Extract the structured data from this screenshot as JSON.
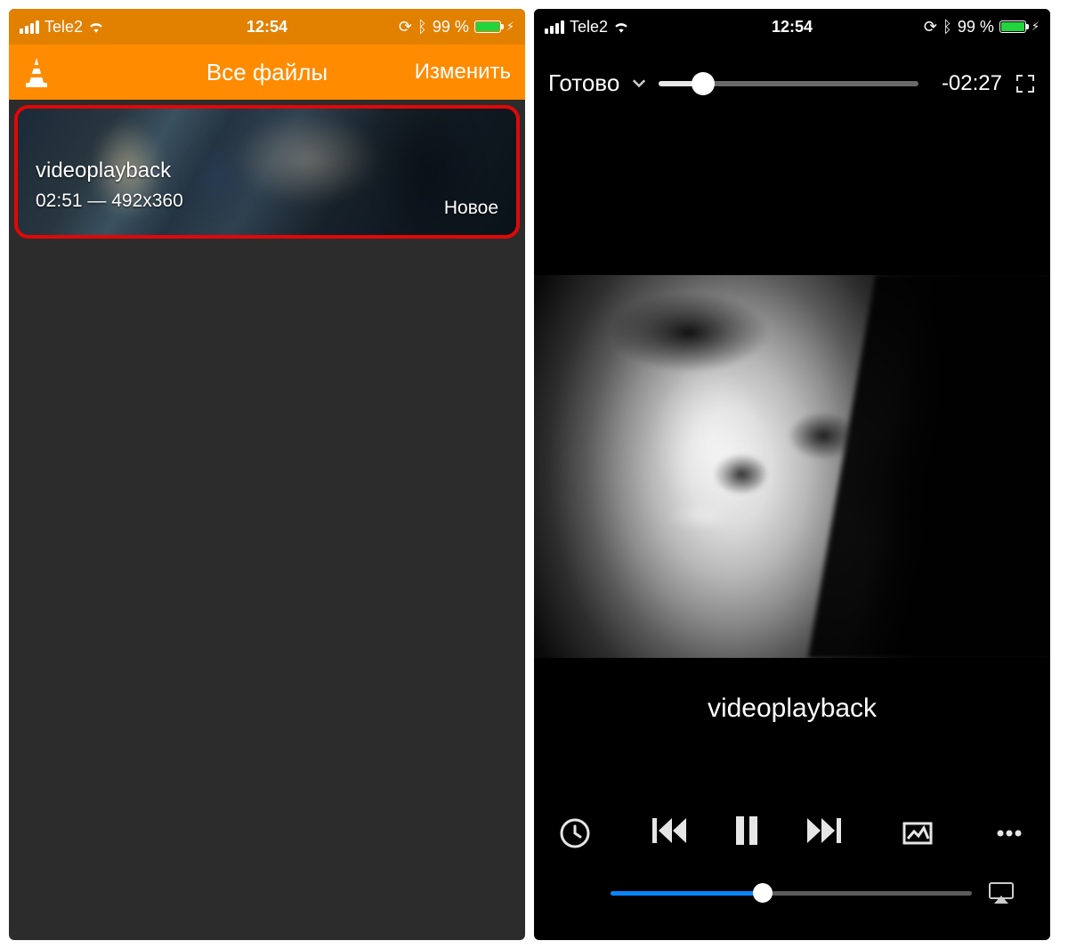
{
  "status": {
    "carrier": "Tele2",
    "time": "12:54",
    "battery_pct": "99 %"
  },
  "left": {
    "nav_title": "Все файлы",
    "edit_label": "Изменить",
    "item": {
      "title": "videoplayback",
      "meta": "02:51 — 492x360",
      "badge": "Новое"
    }
  },
  "right": {
    "done_label": "Готово",
    "remaining": "-02:27",
    "playing_title": "videoplayback",
    "seek_progress_pct": 17,
    "volume_pct": 42
  },
  "colors": {
    "accent_orange": "#ff8b00",
    "highlight_red": "#e20707",
    "volume_blue": "#0a84ff",
    "battery_green": "#22d43e"
  }
}
